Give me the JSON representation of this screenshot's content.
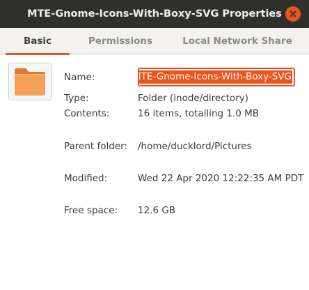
{
  "window": {
    "title": "MTE-Gnome-Icons-With-Boxy-SVG Properties",
    "close_icon": "close-icon",
    "accent_color": "#e9541f"
  },
  "tabs": [
    {
      "label": "Basic",
      "active": true
    },
    {
      "label": "Permissions",
      "active": false
    },
    {
      "label": "Local Network Share",
      "active": false
    }
  ],
  "basic": {
    "icon": "folder-icon",
    "name_label": "Name:",
    "name_value": "MTE-Gnome-Icons-With-Boxy-SVG",
    "type_label": "Type:",
    "type_value": "Folder (inode/directory)",
    "contents_label": "Contents:",
    "contents_value": "16 items, totalling 1.0 MB",
    "parent_label": "Parent folder:",
    "parent_value": "/home/ducklord/Pictures",
    "modified_label": "Modified:",
    "modified_value": "Wed 22 Apr 2020 12:22:35 AM PDT",
    "free_label": "Free space:",
    "free_value": "12.6 GB"
  }
}
